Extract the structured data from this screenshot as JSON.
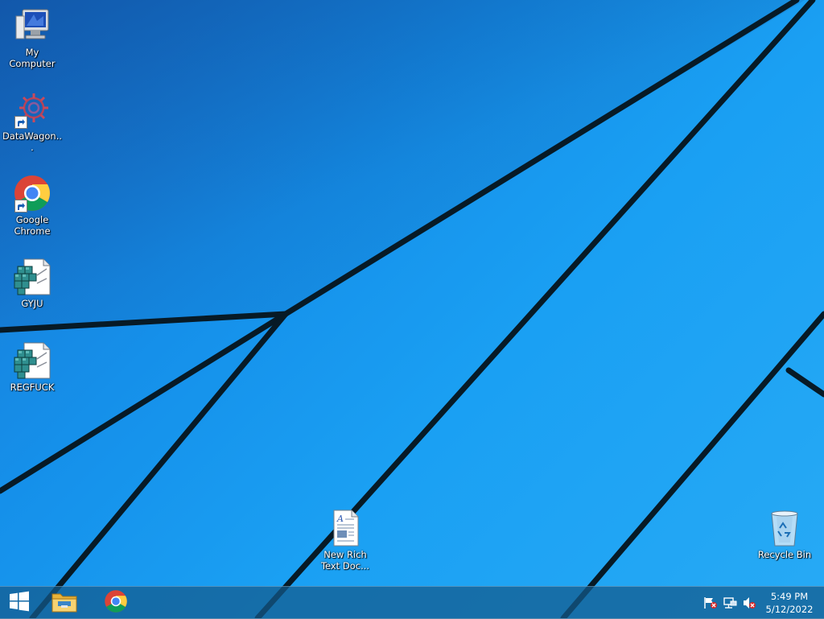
{
  "desktop": {
    "icons": [
      {
        "label": "My Computer",
        "icon": "computer-icon"
      },
      {
        "label": "DataWagon...",
        "icon": "datawagon-icon"
      },
      {
        "label": "Google Chrome",
        "icon": "chrome-icon"
      },
      {
        "label": "GYJU",
        "icon": "registry-file-icon"
      },
      {
        "label": "REGFUCK",
        "icon": "registry-file-icon"
      },
      {
        "label": "New Rich Text Doc...",
        "icon": "rich-text-document-icon"
      },
      {
        "label": "Recycle Bin",
        "icon": "recycle-bin-icon"
      }
    ]
  },
  "taskbar": {
    "pinned": [
      {
        "icon": "windows-start-icon"
      },
      {
        "icon": "file-explorer-icon"
      },
      {
        "icon": "chrome-icon"
      }
    ],
    "tray": {
      "icons": [
        "action-center-flag-icon",
        "network-icon",
        "volume-muted-icon"
      ],
      "time": "5:49 PM",
      "date": "5/12/2022"
    }
  },
  "colors": {
    "wallpaper_blue": "#1a9bf0",
    "taskbar": "#2b6f9c"
  }
}
